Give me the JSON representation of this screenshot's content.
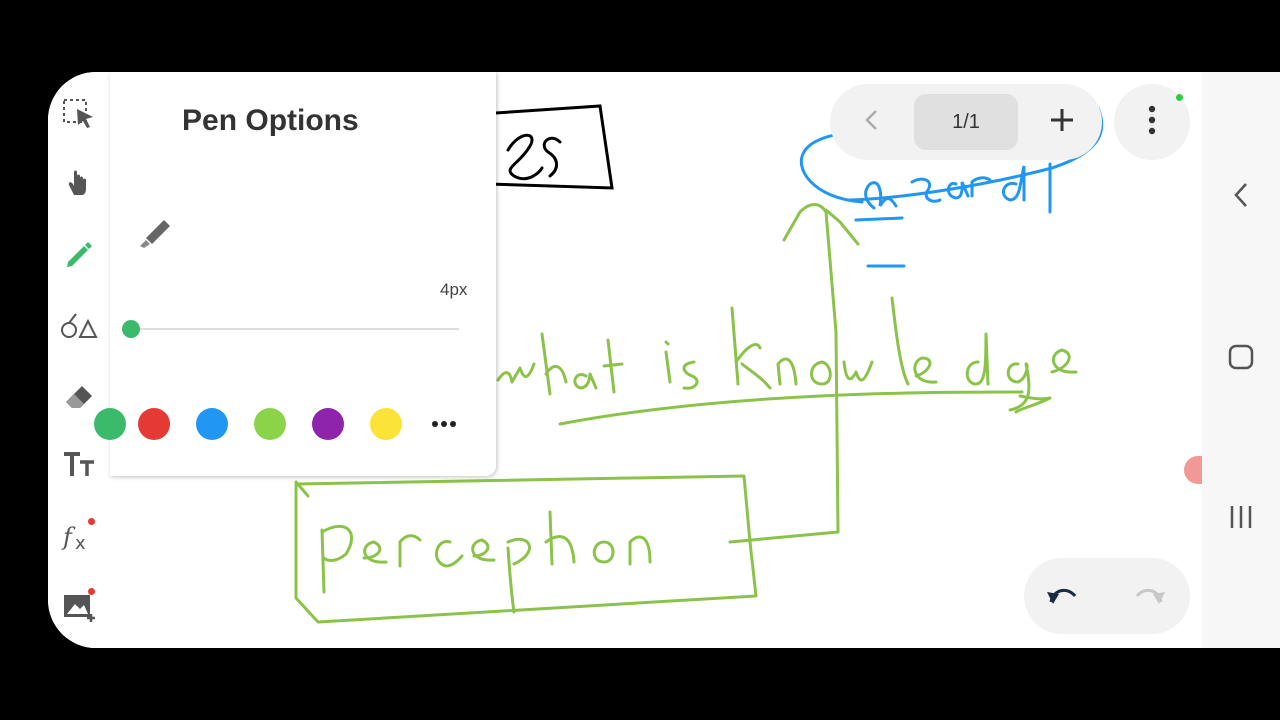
{
  "pen_options": {
    "title": "Pen Options",
    "size_label": "4px",
    "size_level": 0.02,
    "colors": [
      "#3bba6c",
      "#e53935",
      "#2196f3",
      "#8bd44a",
      "#8e24aa",
      "#fbe338"
    ],
    "more_icon": "more-horizontal-icon"
  },
  "page_nav": {
    "indicator": "1/1"
  },
  "toolbar": {
    "icons": [
      "selection-icon",
      "hand-icon",
      "pen-icon",
      "shapes-icon",
      "eraser-icon",
      "text-icon",
      "formula-icon",
      "image-add-icon"
    ]
  },
  "canvas": {
    "ink_color_green": "#8bc34a",
    "ink_color_blue": "#2196f3",
    "ink_color_black": "#000000"
  },
  "system_nav": {
    "icons": [
      "back-icon",
      "home-icon",
      "recents-icon"
    ]
  }
}
